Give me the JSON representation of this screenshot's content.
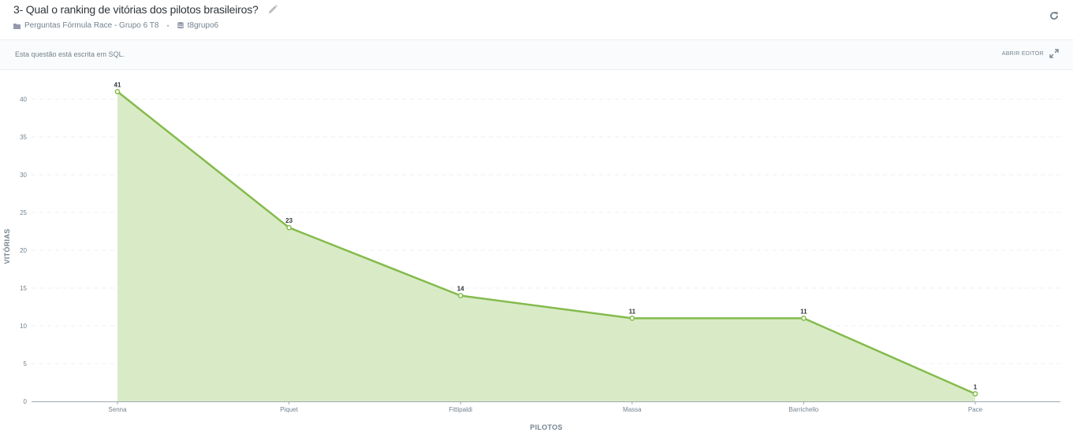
{
  "header": {
    "title": "3- Qual o ranking de vitórias dos pilotos brasileiros?",
    "collection": "Perguntas Fórmula Race - Grupo 6 T8",
    "separator": "•",
    "database": "t8grupo6"
  },
  "sql_bar": {
    "note": "Esta questão está escrita em SQL.",
    "open_editor_label": "ABRIR EDITOR"
  },
  "icons": {
    "edit": "pencil-icon",
    "folder": "folder-icon",
    "database": "database-icon",
    "refresh": "refresh-icon",
    "expand": "expand-icon"
  },
  "colors": {
    "line": "#84bb4c",
    "area": "#d9ebc6",
    "grid": "#eceff0",
    "text": "#74838f"
  },
  "chart_data": {
    "type": "area",
    "xlabel": "PILOTOS",
    "ylabel": "VITÓRIAS",
    "categories": [
      "Senna",
      "Piquet",
      "Fittipaldi",
      "Massa",
      "Barrichello",
      "Pace"
    ],
    "series": [
      {
        "values": [
          41,
          23,
          14,
          11,
          11,
          1
        ]
      }
    ],
    "ylim": [
      0,
      40
    ],
    "yticks": [
      0,
      5,
      10,
      15,
      20,
      25,
      30,
      35,
      40
    ],
    "grid": true,
    "data_labels": true
  }
}
